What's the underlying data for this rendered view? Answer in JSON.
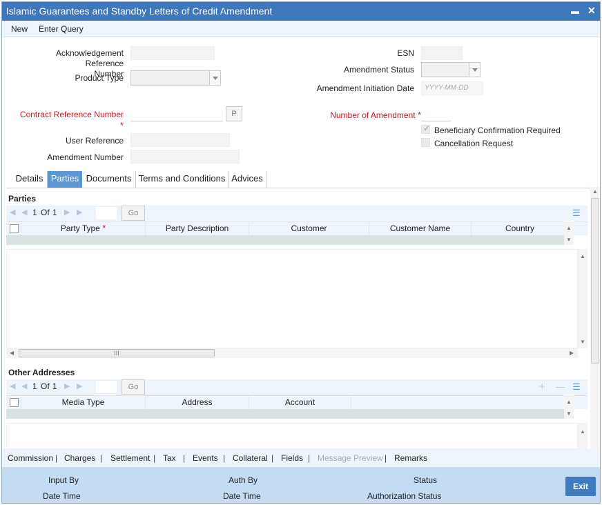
{
  "window": {
    "title": "Islamic Guarantees and Standby Letters of Credit Amendment",
    "minimize_glyph": "▬",
    "close_glyph": "✕"
  },
  "menu": {
    "new": "New",
    "enter_query": "Enter Query"
  },
  "form": {
    "ack_ref_line1": "Acknowledgement Reference",
    "ack_ref_line2": "Number",
    "product_type": "Product Type",
    "contract_ref": "Contract Reference Number",
    "p_button": "P",
    "user_reference": "User Reference",
    "amendment_number": "Amendment Number",
    "esn": "ESN",
    "amendment_status": "Amendment Status",
    "amendment_initiation_date": "Amendment Initiation Date",
    "date_placeholder": "YYYY-MM-DD",
    "number_of_amendment": "Number of Amendment",
    "beneficiary_confirmation": "Beneficiary Confirmation Required",
    "cancellation_request": "Cancellation Request",
    "required_star": "*"
  },
  "tabs": [
    "Details",
    "Parties",
    "Documents",
    "Terms and Conditions",
    "Advices"
  ],
  "parties": {
    "title": "Parties",
    "page": "1",
    "of": "Of",
    "total": "1",
    "go": "Go",
    "columns": [
      "Party Type",
      "Party Description",
      "Customer",
      "Customer Name",
      "Country"
    ]
  },
  "other_addresses": {
    "title": "Other Addresses",
    "page": "1",
    "of": "Of",
    "total": "1",
    "go": "Go",
    "columns": [
      "Media Type",
      "Address",
      "Account"
    ]
  },
  "hscroll_grip": "III",
  "footer_links": [
    "Commission",
    "Charges",
    "Settlement",
    "Tax",
    "Events",
    "Collateral",
    "Fields",
    "Message Preview",
    "Remarks"
  ],
  "footer_sep": "|",
  "status": {
    "input_by": "Input By",
    "date_time": "Date Time",
    "auth_by": "Auth By",
    "date_time2": "Date Time",
    "status": "Status",
    "authorization_status": "Authorization Status",
    "exit": "Exit"
  },
  "icons": {
    "first": "◀",
    "prev": "◀",
    "next": "▶",
    "last": "▶",
    "list": "☰",
    "plus": "+",
    "minus": "—",
    "check": "✓",
    "up": "▲",
    "down": "▼"
  }
}
